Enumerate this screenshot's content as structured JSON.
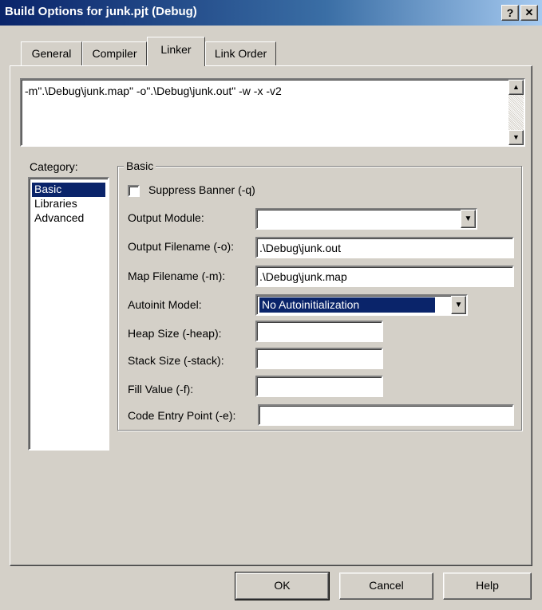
{
  "window": {
    "title": "Build Options for junk.pjt (Debug)",
    "help_glyph": "?",
    "close_glyph": "✕"
  },
  "tabs": [
    {
      "label": "General"
    },
    {
      "label": "Compiler"
    },
    {
      "label": "Linker"
    },
    {
      "label": "Link Order"
    }
  ],
  "active_tab": "Linker",
  "command_line": {
    "value": "-m\".\\Debug\\junk.map\" -o\".\\Debug\\junk.out\" -w -x -v2"
  },
  "category": {
    "label": "Category:",
    "items": [
      {
        "label": "Basic",
        "selected": true
      },
      {
        "label": "Libraries"
      },
      {
        "label": "Advanced"
      }
    ]
  },
  "group": {
    "title": "Basic",
    "suppress_banner": {
      "label": "Suppress Banner (-q)",
      "checked": false
    },
    "output_module": {
      "label": "Output Module:",
      "value": ""
    },
    "output_filename": {
      "label": "Output Filename (-o):",
      "value": ".\\Debug\\junk.out"
    },
    "map_filename": {
      "label": "Map Filename (-m):",
      "value": ".\\Debug\\junk.map"
    },
    "autoinit_model": {
      "label": "Autoinit Model:",
      "value": "No Autoinitialization"
    },
    "heap_size": {
      "label": "Heap Size (-heap):",
      "value": ""
    },
    "stack_size": {
      "label": "Stack Size (-stack):",
      "value": ""
    },
    "fill_value": {
      "label": "Fill Value (-f):",
      "value": ""
    },
    "code_entry_point": {
      "label": "Code Entry Point (-e):",
      "value": ""
    }
  },
  "buttons": {
    "ok": "OK",
    "cancel": "Cancel",
    "help": "Help"
  },
  "icons": {
    "scroll_up": "▲",
    "scroll_down": "▼",
    "dropdown": "▼"
  },
  "colors": {
    "titlebar_start": "#0a246a",
    "titlebar_end": "#a6caf0",
    "dialog_face": "#d4d0c8",
    "selection": "#0a246a"
  }
}
